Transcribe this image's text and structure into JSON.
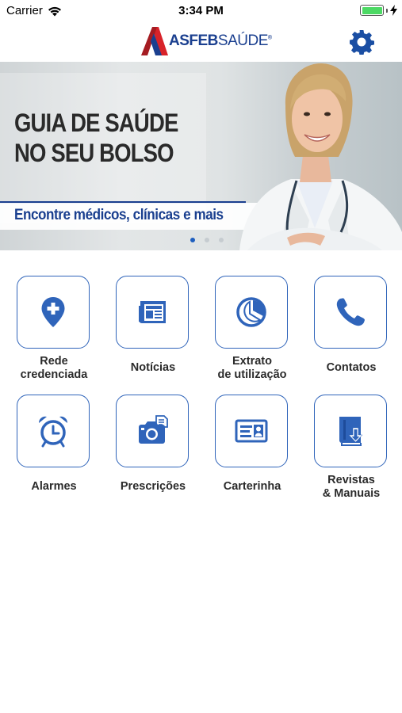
{
  "status_bar": {
    "carrier": "Carrier",
    "time": "3:34 PM",
    "battery_level": 1.0,
    "battery_color": "#4cd964"
  },
  "header": {
    "logo_bold": "ASFEB",
    "logo_light": "SAÚDE",
    "logo_mark": "®",
    "settings_icon": "gear-icon"
  },
  "banner": {
    "title_line1": "GUIA DE SAÚDE",
    "title_line2": "NO SEU BOLSO",
    "subtitle": "Encontre médicos, clínicas e mais",
    "pages": 3,
    "active_page": 1
  },
  "menu": [
    {
      "line1": "Rede",
      "line2": "credenciada",
      "icon": "map-pin-plus-icon"
    },
    {
      "line1": "Notícias",
      "line2": "",
      "icon": "newspaper-icon"
    },
    {
      "line1": "Extrato",
      "line2": "de utilização",
      "icon": "pie-chart-icon"
    },
    {
      "line1": "Contatos",
      "line2": "",
      "icon": "phone-icon"
    },
    {
      "line1": "Alarmes",
      "line2": "",
      "icon": "alarm-clock-icon"
    },
    {
      "line1": "Prescrições",
      "line2": "",
      "icon": "camera-icon"
    },
    {
      "line1": "Carterinha",
      "line2": "",
      "icon": "id-card-icon"
    },
    {
      "line1": "Revistas",
      "line2": "& Manuais",
      "icon": "book-download-icon"
    }
  ],
  "colors": {
    "brand_blue": "#1a3f8f",
    "icon_blue": "#2f64ba",
    "accent_red": "#d8232a"
  }
}
